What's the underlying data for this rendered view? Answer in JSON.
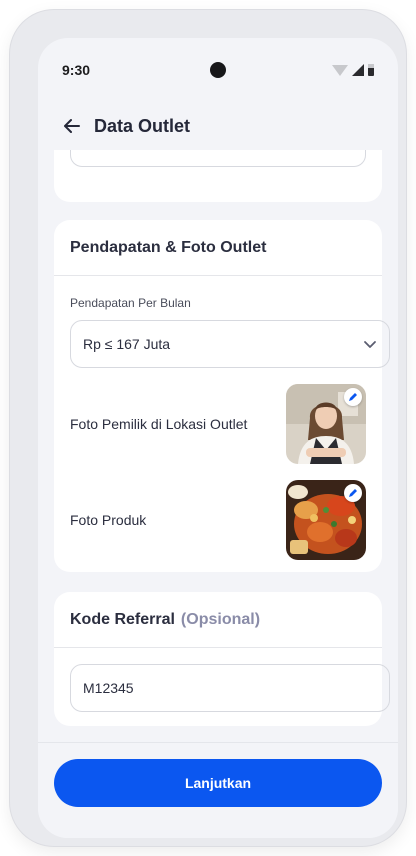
{
  "status_bar": {
    "time": "9:30"
  },
  "header": {
    "title": "Data Outlet"
  },
  "income_section": {
    "title": "Pendapatan & Foto Outlet",
    "income_label": "Pendapatan Per Bulan",
    "income_value": "Rp ≤ 167 Juta",
    "owner_photo_label": "Foto Pemilik di Lokasi Outlet",
    "product_photo_label": "Foto Produk"
  },
  "referral_section": {
    "title": "Kode Referral",
    "optional": "(Opsional)",
    "value": "M12345"
  },
  "footer": {
    "continue_label": "Lanjutkan"
  },
  "colors": {
    "primary": "#0b57f0",
    "muted": "#8a8ca8"
  }
}
